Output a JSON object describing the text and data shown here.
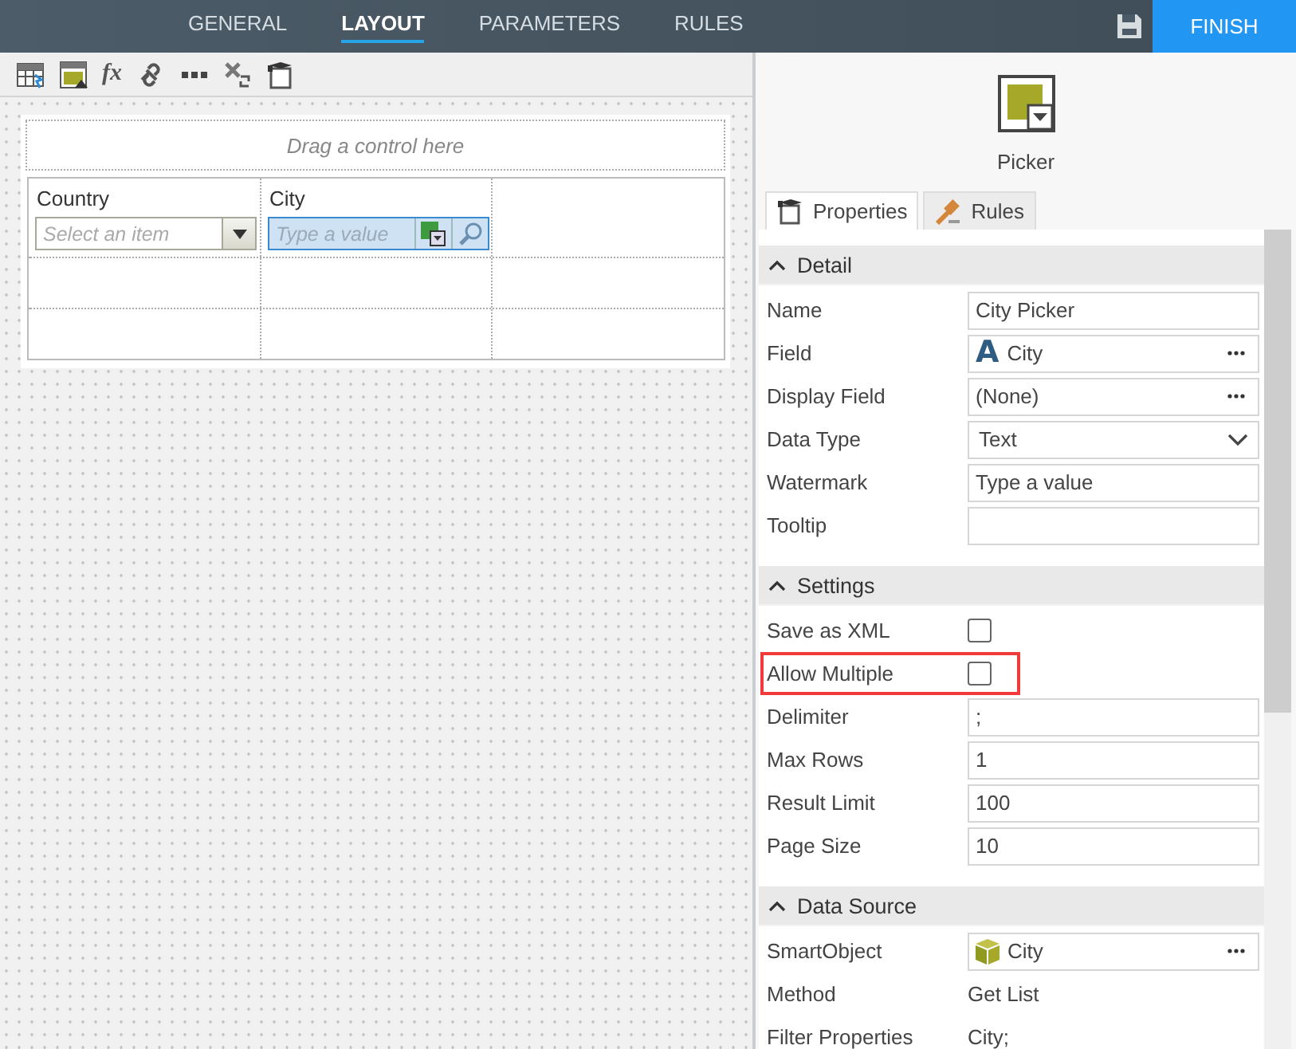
{
  "top_tabs": [
    {
      "label": "GENERAL",
      "selected": false
    },
    {
      "label": "LAYOUT",
      "selected": true
    },
    {
      "label": "PARAMETERS",
      "selected": false
    },
    {
      "label": "RULES",
      "selected": false
    }
  ],
  "finish_button": "FINISH",
  "toolbar": [
    {
      "kind": "table"
    },
    {
      "kind": "view"
    },
    {
      "kind": "text",
      "text": "fx"
    },
    {
      "kind": "link"
    },
    {
      "kind": "dots"
    },
    {
      "kind": "tools"
    },
    {
      "kind": "board"
    }
  ],
  "canvas": {
    "drop_hint": "Drag a control here",
    "rows": [
      [
        {
          "kind": "dropdown",
          "label": "Country",
          "placeholder": "Select an item",
          "selected": false
        },
        {
          "kind": "picker",
          "label": "City",
          "placeholder": "Type a value",
          "selected": true
        },
        {
          "kind": "empty"
        }
      ],
      [
        {
          "kind": "empty"
        },
        {
          "kind": "empty"
        },
        {
          "kind": "empty"
        }
      ],
      [
        {
          "kind": "empty"
        },
        {
          "kind": "empty"
        },
        {
          "kind": "empty"
        }
      ]
    ]
  },
  "control": {
    "name": "Picker"
  },
  "panel_tabs": [
    {
      "label": "Properties",
      "selected": true
    },
    {
      "label": "Rules",
      "selected": false
    }
  ],
  "sections": [
    {
      "title": "Detail",
      "expanded": true,
      "rows": [
        {
          "label": "Name",
          "kind": "text",
          "value": "City Picker"
        },
        {
          "label": "Field",
          "kind": "lookup",
          "glyph": "A",
          "value": "City"
        },
        {
          "label": "Display Field",
          "kind": "lookup",
          "value": "(None)"
        },
        {
          "label": "Data Type",
          "kind": "select",
          "value": "Text"
        },
        {
          "label": "Watermark",
          "kind": "text",
          "value": "Type a value"
        },
        {
          "label": "Tooltip",
          "kind": "text"
        }
      ]
    },
    {
      "title": "Settings",
      "expanded": true,
      "rows": [
        {
          "label": "Save as XML",
          "kind": "checkbox",
          "checked": false,
          "highlighted": false
        },
        {
          "label": "Allow Multiple",
          "kind": "checkbox",
          "checked": false,
          "highlighted": true
        },
        {
          "label": "Delimiter",
          "kind": "text",
          "value": ";"
        },
        {
          "label": "Max Rows",
          "kind": "text",
          "value": "1"
        },
        {
          "label": "Result Limit",
          "kind": "text",
          "value": "100"
        },
        {
          "label": "Page Size",
          "kind": "text",
          "value": "10"
        }
      ]
    },
    {
      "title": "Data Source",
      "expanded": true,
      "rows": [
        {
          "label": "SmartObject",
          "kind": "object",
          "value": "City"
        },
        {
          "label": "Method",
          "kind": "plain",
          "value": "Get List"
        },
        {
          "label": "Filter Properties",
          "kind": "plain",
          "value": "City;"
        }
      ]
    }
  ]
}
